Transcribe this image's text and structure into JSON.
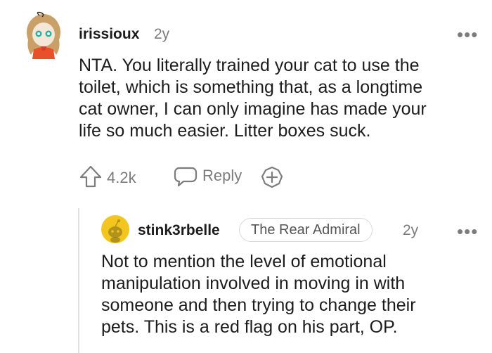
{
  "comment": {
    "username": "irissioux",
    "age": "2y",
    "more_icon": "three-dots-icon",
    "text_lines": [
      "NTA. You literally trained your cat to use the",
      "toilet, which is something that, as a longtime",
      "cat owner, I can only imagine has made your",
      "life so much easier. Litter boxes suck."
    ],
    "upvote_icon": "upvote-arrow-icon",
    "upvote_count": "4.2k",
    "reply_icon": "speech-bubble-icon",
    "reply_label": "Reply",
    "award_icon": "add-award-icon"
  },
  "reply": {
    "username": "stink3rbelle",
    "flair": "The Rear Admiral",
    "age": "2y",
    "more_icon": "three-dots-icon",
    "text_lines": [
      "Not to mention the level of emotional",
      "manipulation involved in moving in with",
      "someone and then trying to change their",
      "pets. This is a red flag on his part, OP."
    ]
  },
  "colors": {
    "avatar_yellow": "#f3c51f",
    "avatar_orange": "#e8502a",
    "muted": "#7c7c7c",
    "text": "#1c1c1c"
  }
}
